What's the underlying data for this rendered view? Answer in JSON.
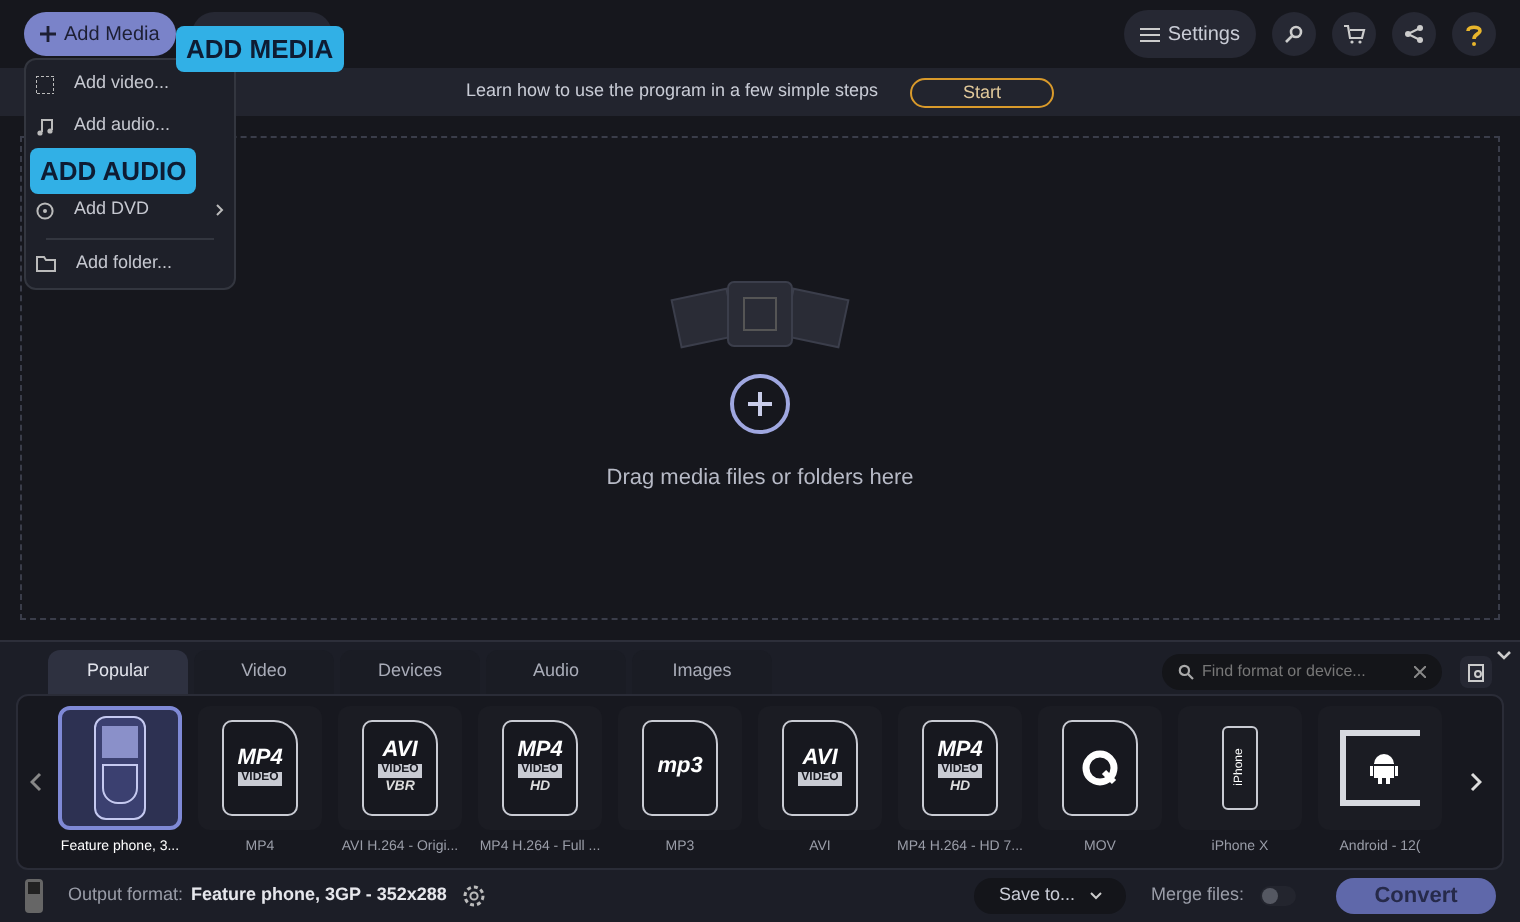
{
  "toolbar": {
    "add_media": "Add Media",
    "settings": "Settings"
  },
  "add_menu": {
    "items": [
      {
        "label": "Add video...",
        "kind": "video",
        "submenu": false
      },
      {
        "label": "Add audio...",
        "kind": "audio",
        "submenu": false
      },
      {
        "label": "Add DVD",
        "kind": "dvd",
        "submenu": true
      },
      {
        "label": "Add folder...",
        "kind": "folder",
        "submenu": false
      }
    ]
  },
  "callouts": [
    {
      "text": "ADD MEDIA"
    },
    {
      "text": "ADD AUDIO"
    }
  ],
  "tutorial_bar": {
    "text": "Learn how to use the program in a few simple steps",
    "button": "Start"
  },
  "drop_zone": {
    "text": "Drag media files or folders here"
  },
  "format_tabs": [
    {
      "label": "Popular",
      "selected": true
    },
    {
      "label": "Video",
      "selected": false
    },
    {
      "label": "Devices",
      "selected": false
    },
    {
      "label": "Audio",
      "selected": false
    },
    {
      "label": "Images",
      "selected": false
    }
  ],
  "search": {
    "placeholder": "Find format or device..."
  },
  "formats": [
    {
      "label": "Feature phone, 3...",
      "kind": "phone",
      "selected": true
    },
    {
      "label": "MP4",
      "kind": "file",
      "selected": false,
      "badge": [
        "MP4",
        "VIDEO"
      ]
    },
    {
      "label": "AVI H.264 - Origi...",
      "kind": "file",
      "selected": false,
      "badge": [
        "AVI",
        "VIDEO",
        "VBR"
      ]
    },
    {
      "label": "MP4 H.264 - Full ...",
      "kind": "file",
      "selected": false,
      "badge": [
        "MP4",
        "VIDEO",
        "HD"
      ]
    },
    {
      "label": "MP3",
      "kind": "file",
      "selected": false,
      "badge": [
        "mp3"
      ]
    },
    {
      "label": "AVI",
      "kind": "file",
      "selected": false,
      "badge": [
        "AVI",
        "VIDEO"
      ]
    },
    {
      "label": "MP4 H.264 - HD 7...",
      "kind": "file",
      "selected": false,
      "badge": [
        "MP4",
        "VIDEO",
        "HD"
      ]
    },
    {
      "label": "MOV",
      "kind": "mov",
      "selected": false
    },
    {
      "label": "iPhone X",
      "kind": "iphone",
      "selected": false,
      "badge": [
        "iPhone"
      ]
    },
    {
      "label": "Android - 12(",
      "kind": "android",
      "selected": false
    }
  ],
  "bottom_bar": {
    "output_label": "Output format:",
    "output_value": "Feature phone, 3GP - 352x288",
    "save_to": "Save to...",
    "merge_label": "Merge files:",
    "merge_on": false,
    "convert": "Convert"
  }
}
